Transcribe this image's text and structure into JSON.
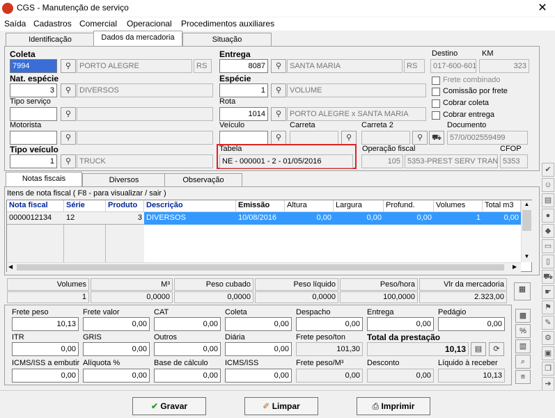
{
  "window": {
    "title": "CGS - Manutenção de serviço",
    "close": "✕"
  },
  "menu": [
    "Saída",
    "Cadastros",
    "Comercial",
    "Operacional",
    "Procedimentos auxiliares"
  ],
  "tabs": [
    "Identificação",
    "Dados da mercadoria",
    "Situação"
  ],
  "coleta": {
    "label": "Coleta",
    "code": "7994",
    "city": "PORTO ALEGRE",
    "uf": "RS"
  },
  "entrega": {
    "label": "Entrega",
    "code": "8087",
    "city": "SANTA MARIA",
    "uf": "RS"
  },
  "destino": {
    "label": "Destino",
    "value": "017-600-601"
  },
  "km": {
    "label": "KM",
    "value": "323"
  },
  "nat_especie": {
    "label": "Nat. espécie",
    "code": "3",
    "desc": "DIVERSOS"
  },
  "especie": {
    "label": "Espécie",
    "code": "1",
    "desc": "VOLUME"
  },
  "checks": {
    "frete_combinado": "Frete combinado",
    "comissao": "Comissão por frete",
    "cobrar_coleta": "Cobrar coleta",
    "cobrar_entrega": "Cobrar entrega"
  },
  "tipo_servico": {
    "label": "Tipo serviço",
    "value": ""
  },
  "rota": {
    "label": "Rota",
    "code": "1014",
    "desc": "PORTO ALEGRE x SANTA MARIA"
  },
  "motorista": {
    "label": "Motorista"
  },
  "veiculo": {
    "label": "Veículo"
  },
  "carreta": {
    "label": "Carreta"
  },
  "carreta2": {
    "label": "Carreta 2"
  },
  "documento": {
    "label": "Documento",
    "value": "57/0/002559499"
  },
  "tipo_veiculo": {
    "label": "Tipo veículo",
    "code": "1",
    "desc": "TRUCK"
  },
  "tabela": {
    "label": "Tabela",
    "value": "NE - 000001 - 2 - 01/05/2016"
  },
  "operacao": {
    "label": "Operação fiscal",
    "code": "105",
    "desc": "5353-PREST SERV TRAN"
  },
  "cfop": {
    "label": "CFOP",
    "value": "5353"
  },
  "subtabs": [
    "Notas fiscais",
    "Diversos",
    "Observação"
  ],
  "grid": {
    "legend": "Itens de nota fiscal ( F8 - para visualizar / sair )",
    "headers": [
      "Nota fiscal",
      "Série",
      "Produto",
      "Descrição",
      "Emissão",
      "Altura",
      "Largura",
      "Profund.",
      "Volumes",
      "Total m3"
    ],
    "row": [
      "0000012134",
      "12",
      "3",
      "DIVERSOS",
      "10/08/2016",
      "0,00",
      "0,00",
      "0,00",
      "1",
      "0,00"
    ]
  },
  "totals": {
    "headers": [
      "Volumes",
      "M³",
      "Peso cubado",
      "Peso líquido",
      "Peso/hora",
      "Vlr da mercadoria"
    ],
    "values": [
      "1",
      "0,0000",
      "0,0000",
      "0,0000",
      "100,0000",
      "2.323,00"
    ]
  },
  "fields": [
    {
      "label": "Frete peso",
      "value": "10,13"
    },
    {
      "label": "Frete valor",
      "value": "0,00"
    },
    {
      "label": "CAT",
      "value": "0,00"
    },
    {
      "label": "Coleta",
      "value": "0,00"
    },
    {
      "label": "Despacho",
      "value": "0,00"
    },
    {
      "label": "Entrega",
      "value": "0,00"
    },
    {
      "label": "Pedágio",
      "value": "0,00"
    },
    {
      "label": "ITR",
      "value": "0,00"
    },
    {
      "label": "GRIS",
      "value": "0,00"
    },
    {
      "label": "Outros",
      "value": "0,00"
    },
    {
      "label": "Diária",
      "value": "0,00"
    },
    {
      "label": "Frete peso/ton",
      "value": "101,30"
    },
    {
      "label": "Total da prestação",
      "value": "10,13"
    },
    {
      "label": "ICMS/ISS a embutir",
      "value": "0,00"
    },
    {
      "label": "Alíquota %",
      "value": "0,00"
    },
    {
      "label": "Base de cálculo",
      "value": "0,00"
    },
    {
      "label": "ICMS/ISS",
      "value": "0,00"
    },
    {
      "label": "Frete peso/M³",
      "value": "0,00"
    },
    {
      "label": "Desconto",
      "value": "0,00"
    },
    {
      "label": "Líquido à receber",
      "value": "10,13"
    }
  ],
  "buttons": {
    "gravar": "Gravar",
    "limpar": "Limpar",
    "imprimir": "Imprimir"
  }
}
